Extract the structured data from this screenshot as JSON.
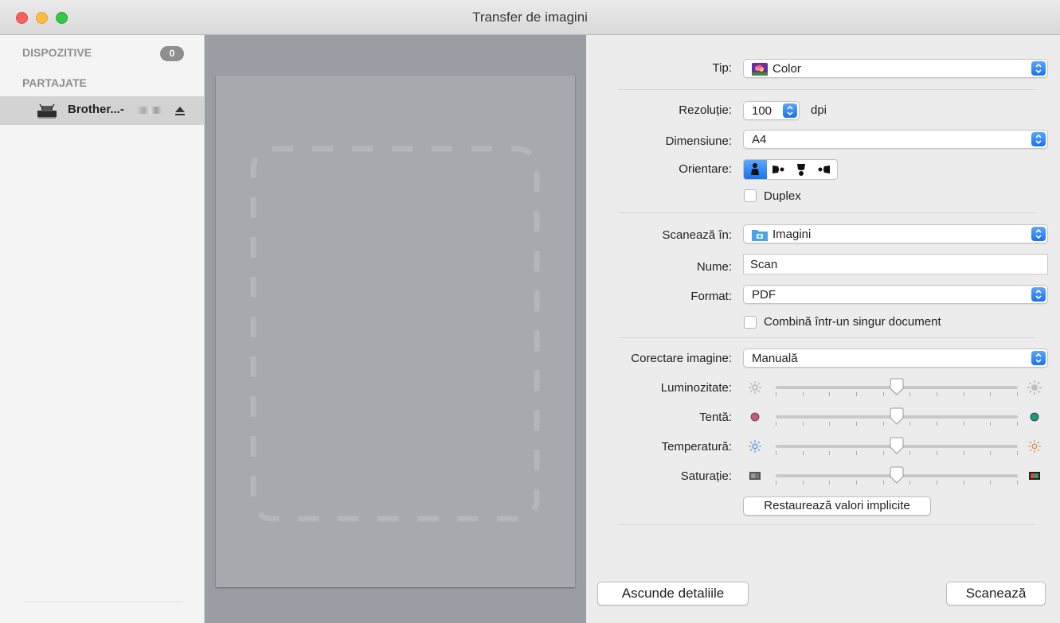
{
  "window": {
    "title": "Transfer de imagini"
  },
  "sidebar": {
    "devices_header": "DISPOZITIVE",
    "devices_count": "0",
    "shared_header": "PARTAJATE",
    "device_name": "Brother...-"
  },
  "settings": {
    "type": {
      "label": "Tip:",
      "value": "Color"
    },
    "resolution": {
      "label": "Rezoluție:",
      "value": "100",
      "unit": "dpi"
    },
    "size": {
      "label": "Dimensiune:",
      "value": "A4"
    },
    "orientation": {
      "label": "Orientare:",
      "selected_index": 0
    },
    "duplex": {
      "label": "Duplex",
      "checked": false
    },
    "scan_to": {
      "label": "Scanează în:",
      "value": "Imagini"
    },
    "name": {
      "label": "Nume:",
      "value": "Scan"
    },
    "format": {
      "label": "Format:",
      "value": "PDF"
    },
    "combine": {
      "label": "Combină într-un singur document",
      "checked": false
    },
    "image_correction": {
      "label": "Corectare imagine:",
      "value": "Manuală"
    },
    "sliders": [
      {
        "label": "Luminozitate:",
        "value": 0.5
      },
      {
        "label": "Tentă:",
        "value": 0.5
      },
      {
        "label": "Temperatură:",
        "value": 0.5
      },
      {
        "label": "Saturație:",
        "value": 0.5
      }
    ],
    "restore_button": "Restaurează valori implicite"
  },
  "footer": {
    "hide_details_button": "Ascunde detaliile",
    "scan_button": "Scanează"
  },
  "colors": {
    "accent": "#1a72ed",
    "hue_left": "#c9587a",
    "hue_right": "#1a9a7c"
  }
}
